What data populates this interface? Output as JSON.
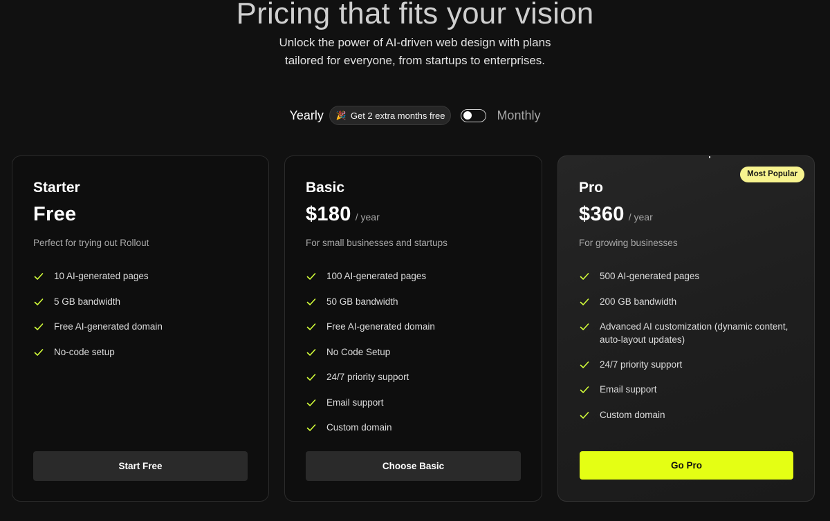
{
  "hero": {
    "title": "Pricing that fits your vision",
    "subtitle_line1": "Unlock the power of AI-driven web design with plans",
    "subtitle_line2": "tailored for everyone, from startups to enterprises."
  },
  "billing": {
    "yearly_label": "Yearly",
    "promo_icon": "party-popper-icon",
    "promo_emoji": "🎉",
    "promo_text": "Get 2 extra months free",
    "monthly_label": "Monthly",
    "toggle_state": "yearly"
  },
  "colors": {
    "background": "#111111",
    "accent": "#e4ff14",
    "check": "#d4ff3a",
    "badge": "#f7f38f"
  },
  "plans": [
    {
      "name": "Starter",
      "price": "Free",
      "period": "",
      "description": "Perfect for trying out Rollout",
      "features": [
        "10 AI-generated pages",
        "5 GB bandwidth",
        "Free AI-generated domain",
        "No-code setup"
      ],
      "cta": "Start Free"
    },
    {
      "name": "Basic",
      "price": "$180",
      "period": "/ year",
      "description": "For small businesses and startups",
      "features": [
        "100 AI-generated pages",
        "50 GB bandwidth",
        "Free AI-generated domain",
        "No Code Setup",
        "24/7 priority support",
        "Email support",
        "Custom domain"
      ],
      "cta": "Choose Basic"
    },
    {
      "name": "Pro",
      "price": "$360",
      "period": "/ year",
      "description": "For growing businesses",
      "badge": "Most Popular",
      "features": [
        "500 AI-generated pages",
        "200 GB bandwidth",
        "Advanced AI customization (dynamic content, auto-layout updates)",
        "24/7 priority support",
        "Email support",
        "Custom domain"
      ],
      "cta": "Go Pro"
    }
  ]
}
